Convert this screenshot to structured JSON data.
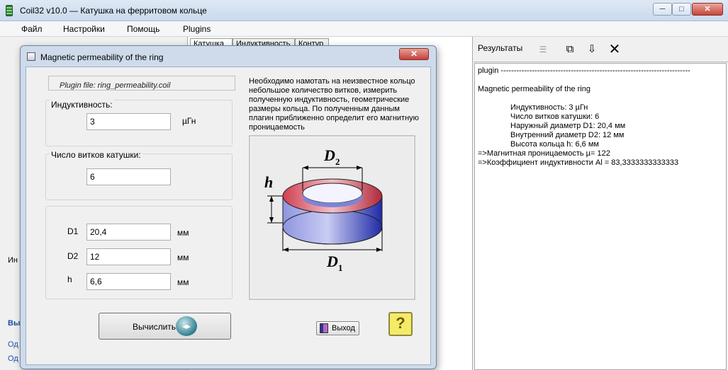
{
  "app": {
    "title": "Coil32 v10.0 — Катушка на ферритовом кольце",
    "min_icon": "minimize-icon",
    "max_icon": "maximize-icon",
    "close_icon": "close-icon"
  },
  "menu": [
    "Файл",
    "Настройки",
    "Помощь",
    "Plugins"
  ],
  "background": {
    "tabs": [
      "Катушка",
      "Индуктивность",
      "Контур"
    ],
    "left_fragments": [
      "Ин",
      "Выч",
      "Од",
      "Од"
    ]
  },
  "results": {
    "header": "Результаты",
    "tools": [
      "list-icon",
      "copy-icon",
      "save-icon",
      "clear-icon"
    ],
    "lines": [
      "plugin -------------------------------------------------------------------------",
      "",
      "Magnetic permeability of the ring",
      "",
      "Индуктивность: 3 µГн",
      "Число витков катушки: 6",
      "Наружный диаметр D1: 20,4 мм",
      "Внутренний диаметр D2: 12 мм",
      "Высота кольца h: 6,6 мм",
      "=>Магнитная проницаемость µ= 122",
      "=>Коэффициент индуктивности Al =  83,3333333333333"
    ]
  },
  "dialog": {
    "title": "Magnetic permeability of the ring",
    "plugin_file": "Plugin file: ring_permeability.coil",
    "inductance_label": "Индуктивность:",
    "inductance_value": "3",
    "inductance_unit": "µГн",
    "turns_label": "Число витков катушки:",
    "turns_value": "6",
    "d1_label": "D1",
    "d1_value": "20,4",
    "d2_label": "D2",
    "d2_value": "12",
    "h_label": "h",
    "h_value": "6,6",
    "mm_unit": "мм",
    "description": "Необходимо намотать на неизвестное кольцо небольшое количество витков, измерить полученную индуктивность, геометрические размеры кольца. По полученным данным плагин приближенно определит его магнитную проницаемость",
    "diagram_labels": {
      "d2": "D",
      "d2_sub": "2",
      "d1": "D",
      "d1_sub": "1",
      "h": "h"
    },
    "calc_button": "Вычислить",
    "exit_button": "Выход",
    "help_glyph": "?"
  },
  "colors": {
    "ring_outer": "#3540b8",
    "ring_inner": "#c04040",
    "dialog_frame": "#cfdbea"
  }
}
